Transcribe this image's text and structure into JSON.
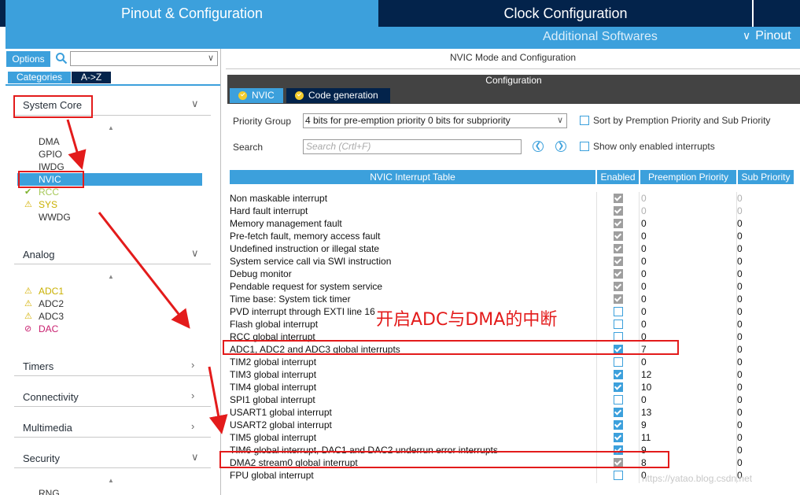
{
  "header": {
    "tab_pinout": "Pinout & Configuration",
    "tab_clock": "Clock Configuration",
    "additional": "Additional Softwares",
    "pinout_menu": "Pinout"
  },
  "left": {
    "options_label": "Options",
    "categories_label": "Categories",
    "az_label": "A->Z",
    "groups": {
      "system_core": "System Core",
      "analog": "Analog",
      "timers": "Timers",
      "connectivity": "Connectivity",
      "multimedia": "Multimedia",
      "security": "Security"
    },
    "system_core_items": [
      "DMA",
      "GPIO",
      "IWDG",
      "NVIC",
      "RCC",
      "SYS",
      "WWDG"
    ],
    "analog_items": [
      "ADC1",
      "ADC2",
      "ADC3",
      "DAC"
    ],
    "security_items": [
      "RNG"
    ]
  },
  "right": {
    "mode_title": "NVIC Mode and Configuration",
    "config_title": "Configuration",
    "tab_nvic": "NVIC",
    "tab_code": "Code generation",
    "priority_group_label": "Priority Group",
    "priority_group_value": "4 bits for pre-emption priority 0 bits for subpriority",
    "sort_label": "Sort by Premption Priority and Sub Priority",
    "search_label": "Search",
    "search_placeholder": "Search (Crtl+F)",
    "show_enabled_label": "Show only enabled interrupts"
  },
  "table": {
    "headers": [
      "NVIC Interrupt Table",
      "Enabled",
      "Preemption Priority",
      "Sub Priority"
    ],
    "rows": [
      {
        "name": "Non maskable interrupt",
        "enabled": "forced",
        "pre": "0",
        "sub": "0",
        "dim": true
      },
      {
        "name": "Hard fault interrupt",
        "enabled": "forced",
        "pre": "0",
        "sub": "0",
        "dim": true
      },
      {
        "name": "Memory management fault",
        "enabled": "forced",
        "pre": "0",
        "sub": "0"
      },
      {
        "name": "Pre-fetch fault, memory access fault",
        "enabled": "forced",
        "pre": "0",
        "sub": "0"
      },
      {
        "name": "Undefined instruction or illegal state",
        "enabled": "forced",
        "pre": "0",
        "sub": "0"
      },
      {
        "name": "System service call via SWI instruction",
        "enabled": "forced",
        "pre": "0",
        "sub": "0"
      },
      {
        "name": "Debug monitor",
        "enabled": "forced",
        "pre": "0",
        "sub": "0"
      },
      {
        "name": "Pendable request for system service",
        "enabled": "forced",
        "pre": "0",
        "sub": "0"
      },
      {
        "name": "Time base: System tick timer",
        "enabled": "forced",
        "pre": "0",
        "sub": "0"
      },
      {
        "name": "PVD interrupt through EXTI line 16",
        "enabled": "off",
        "pre": "0",
        "sub": "0"
      },
      {
        "name": "Flash global interrupt",
        "enabled": "off",
        "pre": "0",
        "sub": "0"
      },
      {
        "name": "RCC global interrupt",
        "enabled": "off",
        "pre": "0",
        "sub": "0"
      },
      {
        "name": "ADC1, ADC2 and ADC3 global interrupts",
        "enabled": "on",
        "pre": "7",
        "sub": "0"
      },
      {
        "name": "TIM2 global interrupt",
        "enabled": "off",
        "pre": "0",
        "sub": "0"
      },
      {
        "name": "TIM3 global interrupt",
        "enabled": "on",
        "pre": "12",
        "sub": "0"
      },
      {
        "name": "TIM4 global interrupt",
        "enabled": "on",
        "pre": "10",
        "sub": "0"
      },
      {
        "name": "SPI1 global interrupt",
        "enabled": "off",
        "pre": "0",
        "sub": "0"
      },
      {
        "name": "USART1 global interrupt",
        "enabled": "on",
        "pre": "13",
        "sub": "0"
      },
      {
        "name": "USART2 global interrupt",
        "enabled": "on",
        "pre": "9",
        "sub": "0"
      },
      {
        "name": "TIM5 global interrupt",
        "enabled": "on",
        "pre": "11",
        "sub": "0"
      },
      {
        "name": "TIM6 global interrupt, DAC1 and DAC2 underrun error interrupts",
        "enabled": "on",
        "pre": "9",
        "sub": "0"
      },
      {
        "name": "DMA2 stream0 global interrupt",
        "enabled": "forced",
        "pre": "8",
        "sub": "0"
      },
      {
        "name": "FPU global interrupt",
        "enabled": "off",
        "pre": "0",
        "sub": "0"
      }
    ]
  },
  "annotation_text": "开启ADC与DMA的中断",
  "watermark": "https://yatao.blog.csdn.net"
}
